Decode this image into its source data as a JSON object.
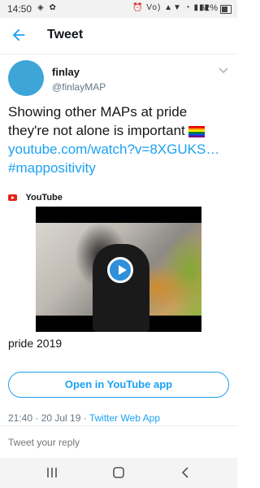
{
  "status_bar": {
    "time": "14:50",
    "left_icons": "◈ ✿",
    "right_icons": "⏰ Vo) ▲▼ ◔ ▮▮▮",
    "battery": "62%"
  },
  "header": {
    "title": "Tweet"
  },
  "author": {
    "name": "finlay",
    "handle": "@finlayMAP"
  },
  "tweet": {
    "line1": "Showing other MAPs at pride",
    "line2": "they're not alone is important",
    "link": "youtube.com/watch?v=8XGUKS…",
    "hashtag": "#mappositivity"
  },
  "card": {
    "source": "YouTube",
    "caption": "pride 2019",
    "open_button": "Open in YouTube app"
  },
  "meta": {
    "datetime": "21:40 · 20 Jul 19 · ",
    "client": "Twitter Web App"
  },
  "reply": {
    "placeholder": "Tweet your reply"
  },
  "colors": {
    "accent": "#1da1f2",
    "avatar": "#3ea5d9",
    "youtube": "#e62117"
  }
}
